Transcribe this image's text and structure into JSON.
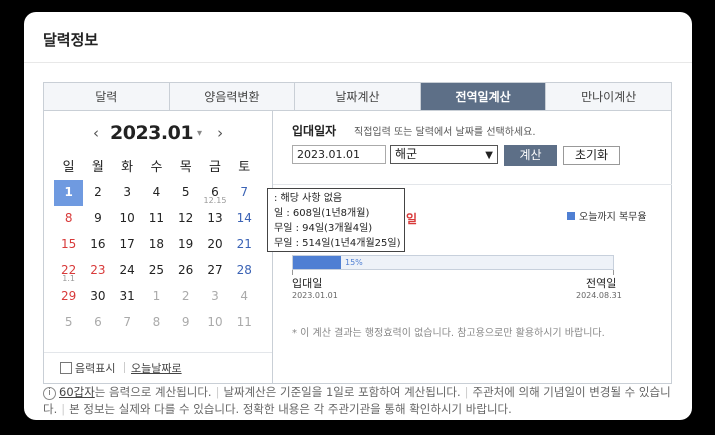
{
  "card": {
    "title": "달력정보"
  },
  "tabs": [
    {
      "label": "달력",
      "active": false
    },
    {
      "label": "양음력변환",
      "active": false
    },
    {
      "label": "날짜계산",
      "active": false
    },
    {
      "label": "전역일계산",
      "active": true
    },
    {
      "label": "만나이계산",
      "active": false
    }
  ],
  "calendar": {
    "year_month": "2023.01",
    "prev_icon": "chevron-left-icon",
    "next_icon": "chevron-right-icon",
    "dropdown_icon": "chevron-down-icon",
    "weekdays": [
      "일",
      "월",
      "화",
      "수",
      "목",
      "금",
      "토"
    ],
    "weeks": [
      [
        {
          "d": "1",
          "sel": true
        },
        {
          "d": "2"
        },
        {
          "d": "3"
        },
        {
          "d": "4"
        },
        {
          "d": "5"
        },
        {
          "d": "6",
          "sub": "12.15"
        },
        {
          "d": "7"
        }
      ],
      [
        {
          "d": "8"
        },
        {
          "d": "9"
        },
        {
          "d": "10"
        },
        {
          "d": "11"
        },
        {
          "d": "12"
        },
        {
          "d": "13"
        },
        {
          "d": "14"
        }
      ],
      [
        {
          "d": "15"
        },
        {
          "d": "16"
        },
        {
          "d": "17"
        },
        {
          "d": "18"
        },
        {
          "d": "19"
        },
        {
          "d": "20"
        },
        {
          "d": "21"
        }
      ],
      [
        {
          "d": "22",
          "sub": "1.1"
        },
        {
          "d": "23",
          "holiday": true
        },
        {
          "d": "24"
        },
        {
          "d": "25"
        },
        {
          "d": "26"
        },
        {
          "d": "27"
        },
        {
          "d": "28"
        }
      ],
      [
        {
          "d": "29"
        },
        {
          "d": "30"
        },
        {
          "d": "31"
        },
        {
          "d": "1",
          "dim": true
        },
        {
          "d": "2",
          "dim": true
        },
        {
          "d": "3",
          "dim": true
        },
        {
          "d": "4",
          "dim": true
        }
      ],
      [
        {
          "d": "5",
          "dim": true
        },
        {
          "d": "6",
          "dim": true
        },
        {
          "d": "7",
          "dim": true
        },
        {
          "d": "8",
          "dim": true
        },
        {
          "d": "9",
          "dim": true
        },
        {
          "d": "10",
          "dim": true
        },
        {
          "d": "11",
          "dim": true
        }
      ]
    ],
    "lunar_toggle_label": "음력표시",
    "lunar_toggle_checked": false,
    "today_link": "오늘날짜로"
  },
  "calc": {
    "start_label": "입대일자",
    "start_desc": "직접입력 또는 달력에서 날짜를 선택하세요.",
    "date_value": "2023.01.01",
    "branch_value": "해군",
    "calc_button": "계산",
    "reset_button": "초기화",
    "result_red_text": "일",
    "legend": "오늘까지 복무율",
    "tooltip": [
      ": 해당 사항 없음",
      "일 : 608일(1년8개월)",
      "무일 : 94일(3개월4일)",
      "무일 : 514일(1년4개월25일)"
    ],
    "progress_percent": 15,
    "progress_label": "15%",
    "start_end_label": "입대일",
    "start_end_date": "2023.01.01",
    "end_label": "전역일",
    "end_date": "2024.08.31",
    "disclaimer": "* 이 계산 결과는 행정효력이 없습니다. 참고용으로만 활용하시기 바랍니다."
  },
  "notes": {
    "info_icon": "info-icon",
    "gapja_link": "60갑자",
    "n1": "는 음력으로 계산됩니다.",
    "n2": "날짜계산은 기준일을 1일로 포함하여 계산됩니다.",
    "n3": "주관처에 의해 기념일이 변경될 수 있습니다.",
    "n4": "본 정보는 실제와 다를 수 있습니다. 정확한 내용은 각 주관기관을 통해 확인하시기 바랍니다."
  },
  "colors": {
    "accent": "#5d6f87",
    "progress": "#4f7fd3",
    "sunday": "#d83a3a",
    "saturday": "#3b63b5",
    "selected": "#6f9ae0"
  }
}
